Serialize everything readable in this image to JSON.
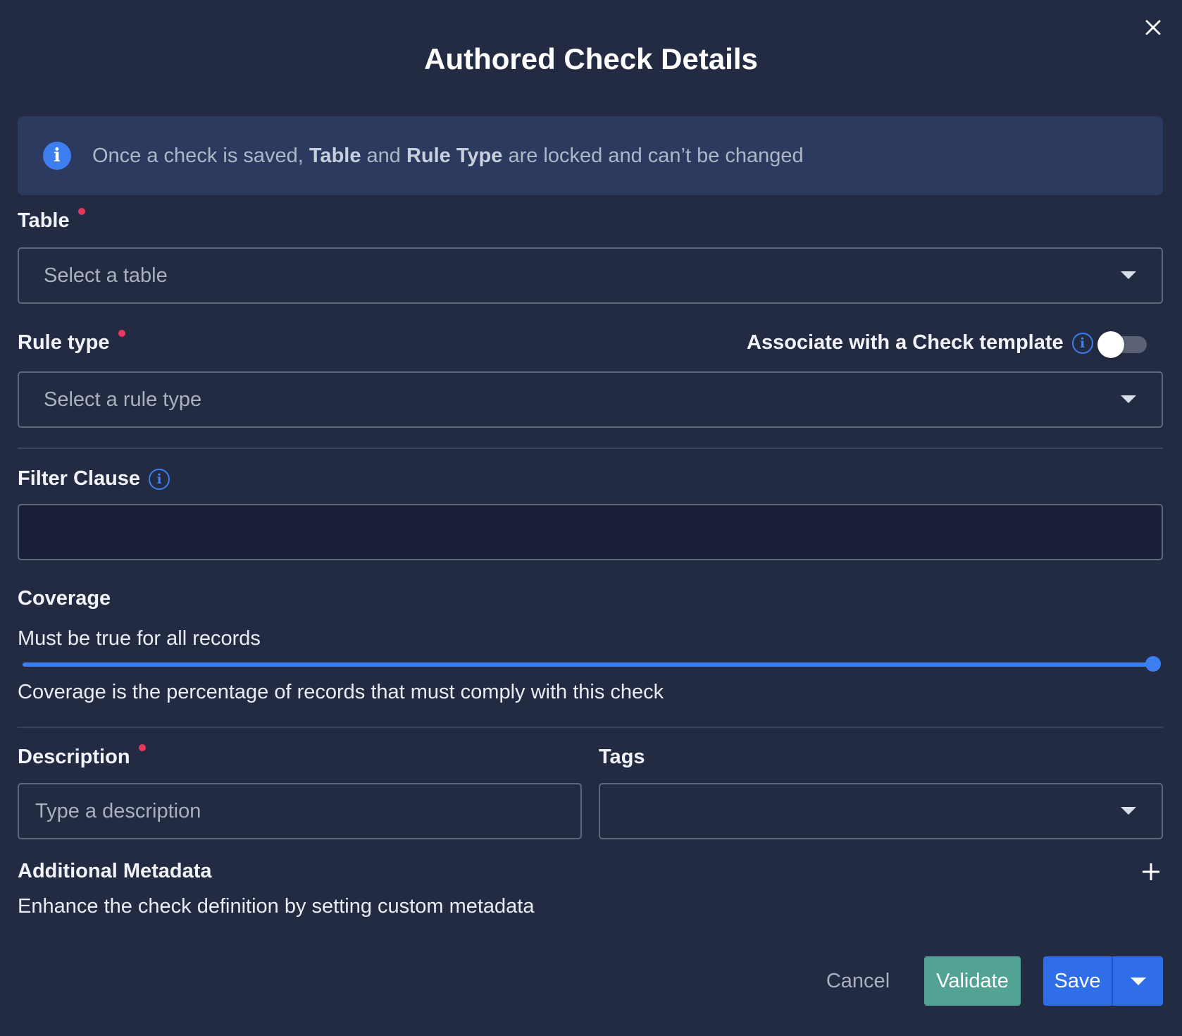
{
  "dialog": {
    "title": "Authored Check Details"
  },
  "info_banner": {
    "text_part1": "Once a check is saved, ",
    "bold1": "Table",
    "text_part2": " and ",
    "bold2": "Rule Type",
    "text_part3": " are locked and can’t be changed"
  },
  "table_field": {
    "label": "Table",
    "required": true,
    "placeholder": "Select a table"
  },
  "rule_type_field": {
    "label": "Rule type",
    "required": true,
    "placeholder": "Select a rule type"
  },
  "check_template": {
    "label": "Associate with a Check template",
    "enabled": false
  },
  "filter_clause": {
    "label": "Filter Clause",
    "value": ""
  },
  "coverage": {
    "label": "Coverage",
    "value_text": "Must be true for all records",
    "percent": 100,
    "help_text": "Coverage is the percentage of records that must comply with this check"
  },
  "description_field": {
    "label": "Description",
    "required": true,
    "placeholder": "Type a description"
  },
  "tags_field": {
    "label": "Tags",
    "value": ""
  },
  "additional_metadata": {
    "label": "Additional Metadata",
    "help_text": "Enhance the check definition by setting custom metadata"
  },
  "actions": {
    "cancel_label": "Cancel",
    "validate_label": "Validate",
    "save_label": "Save"
  },
  "colors": {
    "background": "#232b42",
    "accent_blue": "#3d7ef0",
    "validate_green": "#52a393",
    "required_dot": "#e8365d",
    "banner_bg": "#2b3a5e",
    "filter_input_bg": "#1b2039"
  },
  "icons": {
    "close": "close-icon",
    "info": "info-icon",
    "caret": "caret-down-icon",
    "plus": "plus-icon"
  }
}
